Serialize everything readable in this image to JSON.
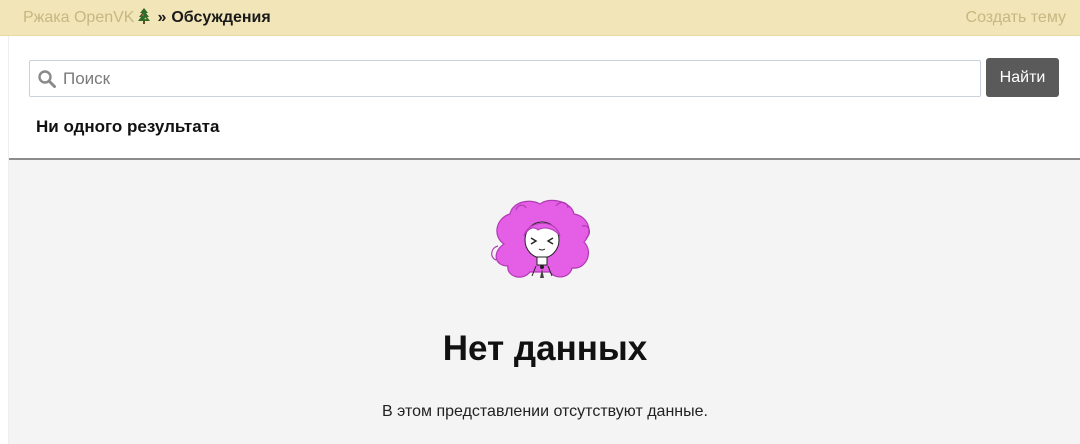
{
  "header": {
    "breadcrumb_root": "Ржака OpenVK",
    "breadcrumb_separator": "»",
    "breadcrumb_current": "Обсуждения",
    "create_topic_label": "Создать тему",
    "bar_color": "#f2e6b8",
    "link_color": "#c7b780"
  },
  "search": {
    "placeholder": "Поиск",
    "value": "",
    "button_label": "Найти",
    "results_label": "Ни одного результата"
  },
  "empty_state": {
    "title": "Нет данных",
    "description": "В этом представлении отсутствуют данные.",
    "illustration": "mascot-girl-pink-hair"
  },
  "icons": {
    "tree": "tree-icon",
    "search": "search-icon"
  }
}
